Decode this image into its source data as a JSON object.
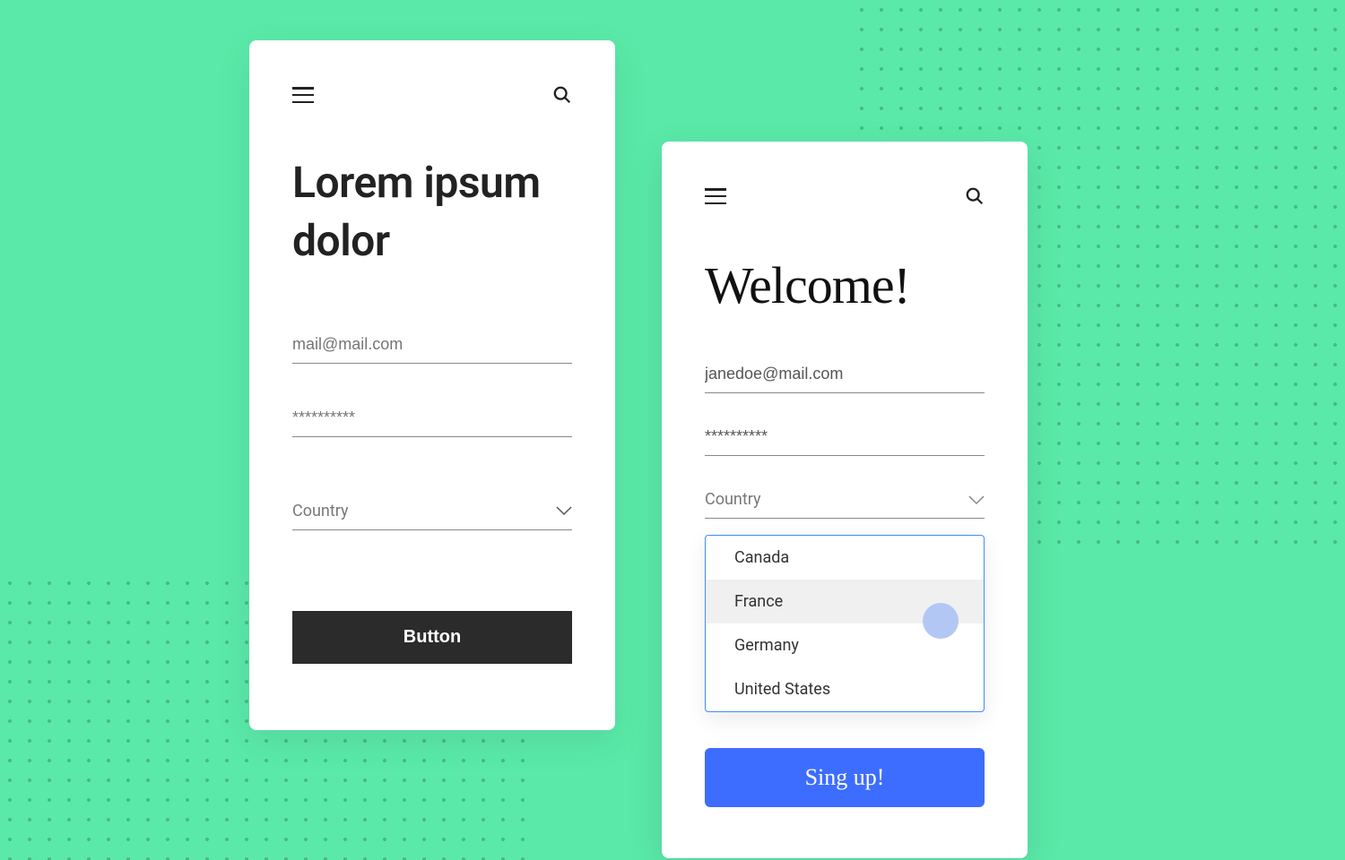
{
  "left_screen": {
    "heading": "Lorem ipsum dolor",
    "email_placeholder": "mail@mail.com",
    "password_placeholder": "**********",
    "country_placeholder": "Country",
    "button_label": "Button"
  },
  "right_screen": {
    "heading": "Welcome!",
    "email_value": "janedoe@mail.com",
    "password_value": "**********",
    "country_placeholder": "Country",
    "dropdown_items": [
      "Canada",
      "France",
      "Germany",
      "United States"
    ],
    "dropdown_highlighted": "France",
    "button_label": "Sing up!"
  }
}
